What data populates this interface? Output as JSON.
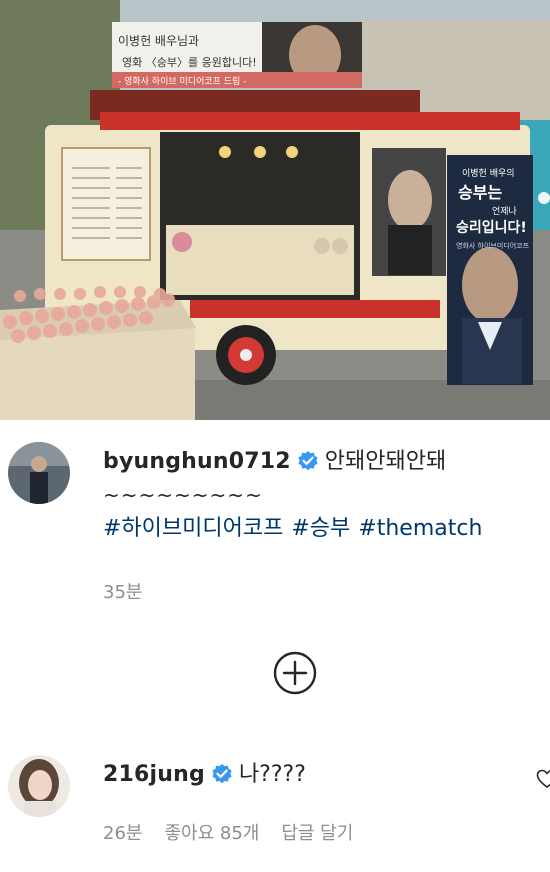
{
  "photo": {
    "banner_line1": "이병헌 배우님과",
    "banner_line2": "영화 〈승부〉를 응원합니다!",
    "banner_sub": "- 영화사 하이브 미디어코프 드림 -",
    "poster_line1": "이병헌 배우의",
    "poster_line2": "승부는",
    "poster_line3": "언제나",
    "poster_line4": "승리입니다!",
    "poster_sub": "영화사 하이브미디어코프"
  },
  "comments": [
    {
      "username": "byunghun0712",
      "text": "안돼안돼안돼",
      "line2": "~~~~~~~~~",
      "hashtags": [
        "#하이브미디어코프",
        "#승부",
        "#thematch"
      ],
      "time": "35분"
    },
    {
      "username": "216jung",
      "text": "나????",
      "time": "26분",
      "likes": "좋아요 85개",
      "reply": "답글 달기"
    }
  ],
  "colors": {
    "verified": "#3897f0",
    "hashtag": "#00376b",
    "meta": "#8e8e8e"
  },
  "icons": {
    "load_more": "plus-circle-icon",
    "like": "heart-icon"
  }
}
